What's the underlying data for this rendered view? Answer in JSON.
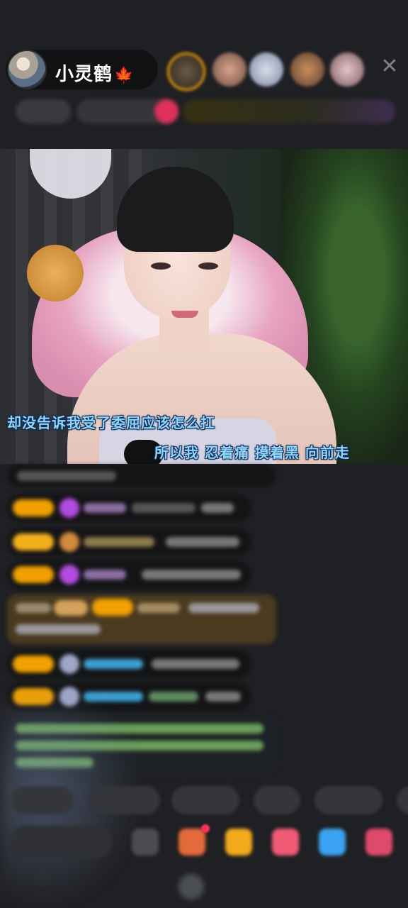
{
  "header": {
    "host_name": "小灵鹤",
    "host_badge_icon": "maple-leaf-icon",
    "close_icon": "close-icon"
  },
  "video": {
    "subtitle_line1": "却没告诉我受了委屈应该怎么扛",
    "subtitle_line2": "所以我 忍着痛 摸着黑 向前走"
  },
  "colors": {
    "background": "#1f2023",
    "subtitle_text": "#8fd6ff",
    "subtitle_outline": "#0d2a52",
    "level_badge": "#f0a000"
  }
}
